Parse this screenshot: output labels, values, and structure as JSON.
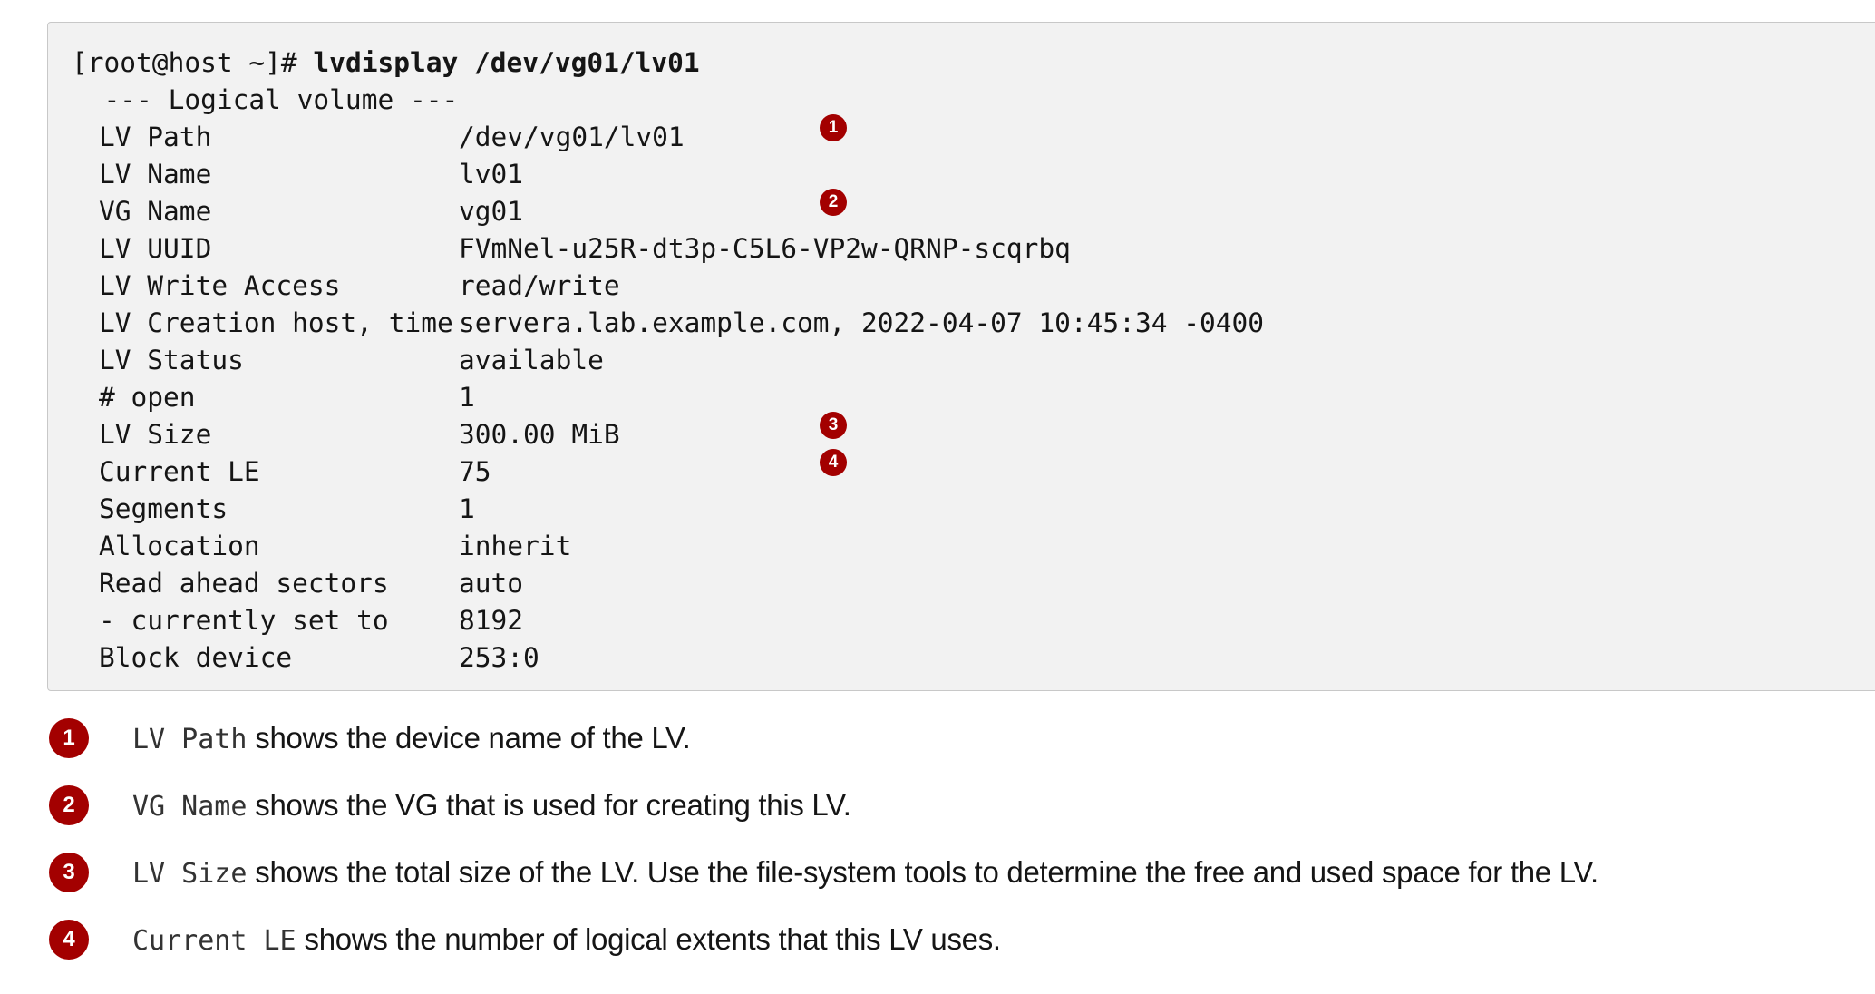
{
  "terminal": {
    "prompt": "[root@host ~]# ",
    "command": "lvdisplay /dev/vg01/lv01",
    "section_header": "  --- Logical volume ---",
    "rows": [
      {
        "key": "LV Path",
        "value": "/dev/vg01/lv01"
      },
      {
        "key": "LV Name",
        "value": "lv01"
      },
      {
        "key": "VG Name",
        "value": "vg01"
      },
      {
        "key": "LV UUID",
        "value": "FVmNel-u25R-dt3p-C5L6-VP2w-QRNP-scqrbq"
      },
      {
        "key": "LV Write Access",
        "value": "read/write"
      },
      {
        "key": "LV Creation host, time",
        "value": "servera.lab.example.com, 2022-04-07 10:45:34 -0400"
      },
      {
        "key": "LV Status",
        "value": "available"
      },
      {
        "key": "# open",
        "value": "1"
      },
      {
        "key": "LV Size",
        "value": "300.00 MiB"
      },
      {
        "key": "Current LE",
        "value": "75"
      },
      {
        "key": "Segments",
        "value": "1"
      },
      {
        "key": "Allocation",
        "value": "inherit"
      },
      {
        "key": "Read ahead sectors",
        "value": "auto"
      },
      {
        "key": "- currently set to",
        "value": "8192"
      },
      {
        "key": "Block device",
        "value": "253:0"
      }
    ],
    "markers": [
      {
        "number": "1"
      },
      {
        "number": "2"
      },
      {
        "number": "3"
      },
      {
        "number": "4"
      }
    ]
  },
  "callouts": [
    {
      "number": "1",
      "code": "LV Path",
      "text": " shows the device name of the LV."
    },
    {
      "number": "2",
      "code": "VG Name",
      "text": " shows the VG that is used for creating this LV."
    },
    {
      "number": "3",
      "code": "LV Size",
      "text": " shows the total size of the LV. Use the file-system tools to determine the free and used space for the LV."
    },
    {
      "number": "4",
      "code": "Current LE",
      "text": " shows the number of logical extents that this LV uses."
    }
  ],
  "colors": {
    "marker": "#a30000",
    "code_background": "#f2f2f2",
    "text": "#151515"
  }
}
